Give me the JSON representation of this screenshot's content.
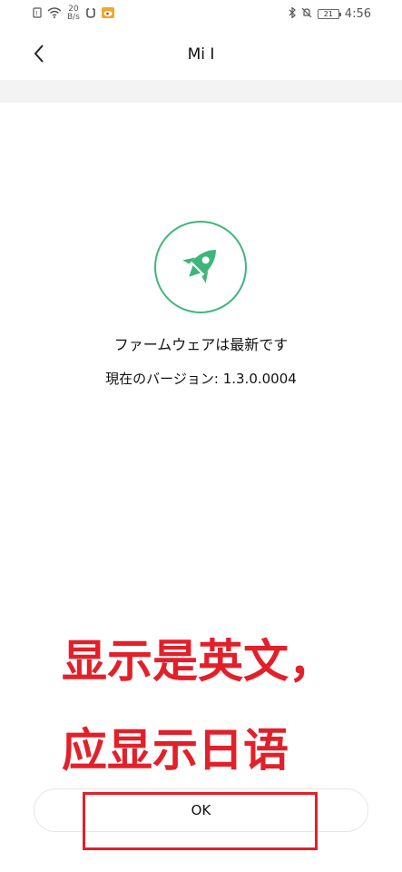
{
  "status_bar": {
    "net_speed_value": "20",
    "net_speed_unit": "B/s",
    "battery_level": "21",
    "time": "4:56"
  },
  "header": {
    "title": "Mi I"
  },
  "main": {
    "status_text": "ファームウェアは最新です",
    "version_text": "現在のバージョン: 1.3.0.0004"
  },
  "annotation": {
    "line1": "显示是英文，",
    "line2": "应显示日语"
  },
  "ok_button": {
    "label": "OK"
  },
  "colors": {
    "accent_green": "#3fb57a",
    "annotation_red": "#e2202a"
  }
}
